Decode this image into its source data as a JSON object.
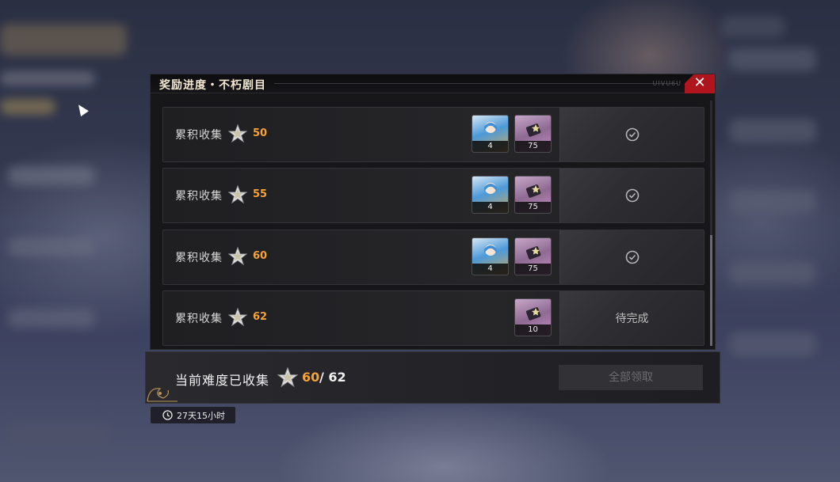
{
  "dialog": {
    "title": "奖励进度・不朽剧目",
    "header_deco": "UIVU6U",
    "close_icon": "close-icon"
  },
  "rows": [
    {
      "label": "累积收集",
      "count": "50",
      "rewards": [
        {
          "type": "character",
          "qty": "4"
        },
        {
          "type": "item",
          "qty": "75"
        }
      ],
      "status": "claimed"
    },
    {
      "label": "累积收集",
      "count": "55",
      "rewards": [
        {
          "type": "character",
          "qty": "4"
        },
        {
          "type": "item",
          "qty": "75"
        }
      ],
      "status": "claimed"
    },
    {
      "label": "累积收集",
      "count": "60",
      "rewards": [
        {
          "type": "character",
          "qty": "4"
        },
        {
          "type": "item",
          "qty": "75"
        }
      ],
      "status": "claimed"
    },
    {
      "label": "累积收集",
      "count": "62",
      "rewards": [
        {
          "type": "item",
          "qty": "10"
        }
      ],
      "status": "pending",
      "status_text": "待完成"
    }
  ],
  "footer": {
    "label": "当前难度已收集",
    "current": "60",
    "separator": "/",
    "total": "62",
    "claim_all": "全部领取"
  },
  "timer": {
    "text": "27天15小时",
    "icon": "clock-icon"
  },
  "colors": {
    "accent": "#f5a238",
    "close": "#b0141c"
  }
}
